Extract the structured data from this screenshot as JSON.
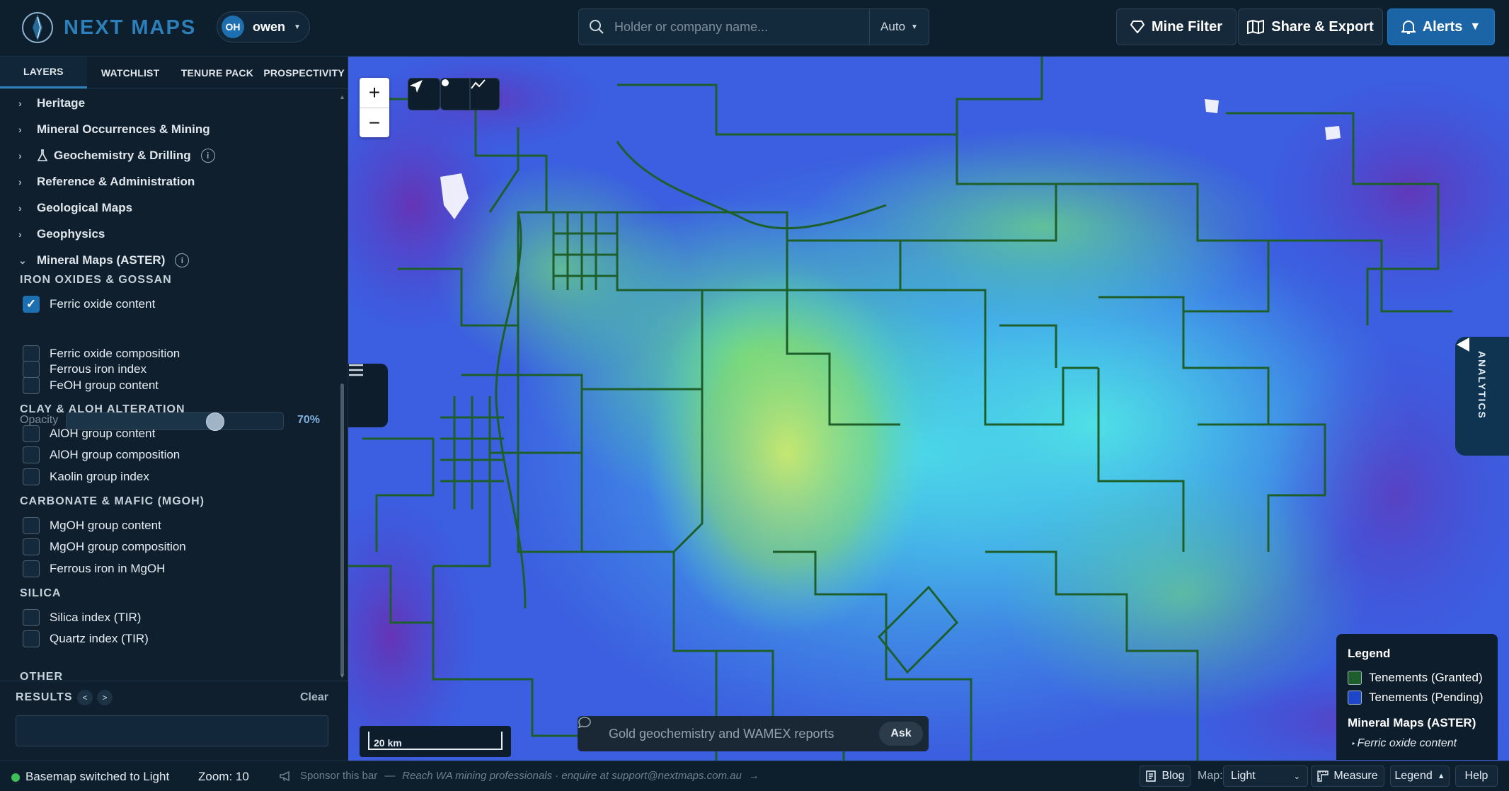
{
  "header": {
    "logo_text": "NEXT MAPS",
    "user": {
      "initials": "OH",
      "name": "owen"
    },
    "search": {
      "placeholder": "Holder or company name...",
      "mode": "Auto"
    },
    "buttons": {
      "mine_filter": "Mine Filter",
      "share_export": "Share & Export",
      "alerts": "Alerts"
    }
  },
  "sidebar": {
    "tabs": [
      "LAYERS",
      "WATCHLIST",
      "TENURE PACK",
      "PROSPECTIVITY"
    ],
    "active_tab": "LAYERS",
    "groups": [
      {
        "label": "Heritage"
      },
      {
        "label": "Mineral Occurrences & Mining"
      },
      {
        "label": "Geochemistry & Drilling"
      },
      {
        "label": "Reference & Administration"
      },
      {
        "label": "Geological Maps"
      },
      {
        "label": "Geophysics"
      },
      {
        "label": "Mineral Maps (ASTER)",
        "expanded": true
      }
    ],
    "sections": [
      {
        "title": "IRON OXIDES & GOSSAN",
        "items": [
          "Ferric oxide content",
          "Ferric oxide composition",
          "Ferrous iron index",
          "FeOH group content"
        ]
      },
      {
        "title": "CLAY & ALOH ALTERATION",
        "items": [
          "AlOH group content",
          "AlOH group composition",
          "Kaolin group index"
        ]
      },
      {
        "title": "CARBONATE & MAFIC (MGOH)",
        "items": [
          "MgOH group content",
          "MgOH group composition",
          "Ferrous iron in MgOH"
        ]
      },
      {
        "title": "SILICA",
        "items": [
          "Silica index (TIR)",
          "Quartz index (TIR)"
        ]
      },
      {
        "title": "OTHER",
        "items": []
      }
    ],
    "checked_item": "Ferric oxide content",
    "opacity": {
      "label": "Opacity",
      "value": "70%",
      "fraction": 0.7
    },
    "results": {
      "label": "RESULTS",
      "prev": "<",
      "next": ">",
      "clear": "Clear"
    }
  },
  "map": {
    "zoom_in": "+",
    "zoom_out": "−",
    "tools": [
      "navigate-icon",
      "point-icon",
      "line-icon"
    ],
    "analytics_label": "ANALYTICS",
    "scale": "20 km",
    "ask": {
      "placeholder": "Gold geochemistry and WAMEX reports",
      "button": "Ask"
    },
    "legend": {
      "title": "Legend",
      "entries": [
        {
          "label": "Tenements (Granted)",
          "color": "#1e5e2a"
        },
        {
          "label": "Tenements (Pending)",
          "color": "#1d47c8"
        }
      ],
      "subtitle": "Mineral Maps (ASTER)",
      "active_layer": "Ferric oxide content"
    }
  },
  "statusbar": {
    "status": "Basemap switched to Light",
    "zoom": "Zoom: 10",
    "sponsor": "Sponsor this bar",
    "sponsor_message": "Reach WA mining professionals · enquire at support@nextmaps.com.au",
    "blog": "Blog",
    "map_label": "Map:",
    "basemap": "Light",
    "measure": "Measure",
    "legend": "Legend",
    "help": "Help"
  },
  "colors": {
    "accent": "#1b65a6",
    "status_ok": "#3fbf5a",
    "tenement_outline": "#1e5e2a"
  }
}
